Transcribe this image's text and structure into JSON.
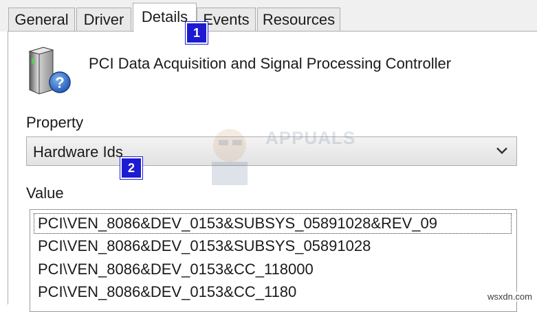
{
  "tabs": [
    {
      "label": "General",
      "active": false
    },
    {
      "label": "Driver",
      "active": false
    },
    {
      "label": "Details",
      "active": true
    },
    {
      "label": "Events",
      "active": false
    },
    {
      "label": "Resources",
      "active": false
    }
  ],
  "device": {
    "icon": "device-unknown-icon",
    "name": "PCI Data Acquisition and Signal Processing Controller"
  },
  "property": {
    "label": "Property",
    "selected": "Hardware Ids",
    "icon": "chevron-down-icon"
  },
  "value": {
    "label": "Value",
    "items": [
      "PCI\\VEN_8086&DEV_0153&SUBSYS_05891028&REV_09",
      "PCI\\VEN_8086&DEV_0153&SUBSYS_05891028",
      "PCI\\VEN_8086&DEV_0153&CC_118000",
      "PCI\\VEN_8086&DEV_0153&CC_1180"
    ]
  },
  "callouts": [
    "1",
    "2"
  ],
  "watermark": {
    "text": "APPUALS"
  },
  "footer": {
    "site": "wsxdn.com"
  },
  "colors": {
    "callout": "#1d1bd1",
    "tab_border": "#adadad",
    "panel_bg": "#f0f0f0"
  }
}
